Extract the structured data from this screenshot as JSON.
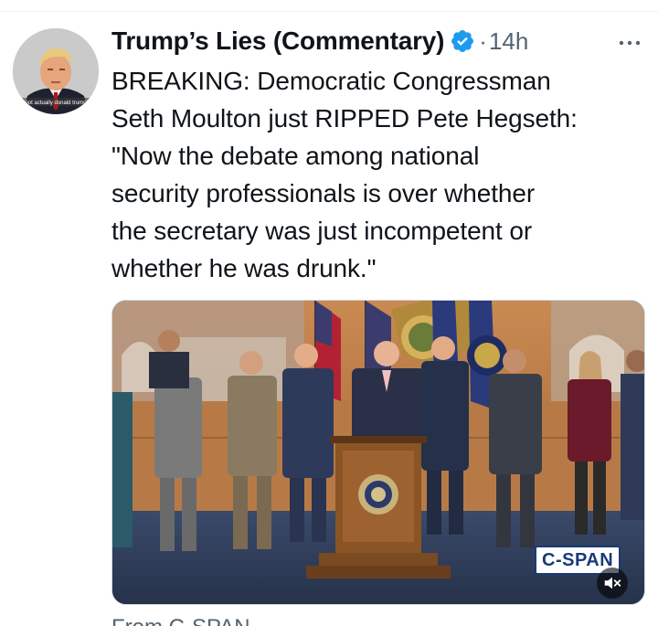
{
  "tweet": {
    "display_name": "Trump’s Lies (Commentary)",
    "dot": "·",
    "timestamp": "14h",
    "text_lines": [
      "BREAKING: Democratic Congressman",
      "Seth Moulton just RIPPED Pete Hegseth:",
      "\"Now the debate among national",
      "security professionals is over whether",
      "the secretary was just incompetent or",
      "whether he was drunk.\""
    ],
    "avatar_caption": "not actually donald trump",
    "from_line": "From C-SPAN"
  },
  "media": {
    "broadcaster_logo": "C-SPAN",
    "mute_icon": "speaker-muted-icon"
  },
  "colors": {
    "text_primary": "#0f1419",
    "text_secondary": "#536471",
    "verified": "#1d9bf0",
    "divider": "#eff3f4"
  }
}
